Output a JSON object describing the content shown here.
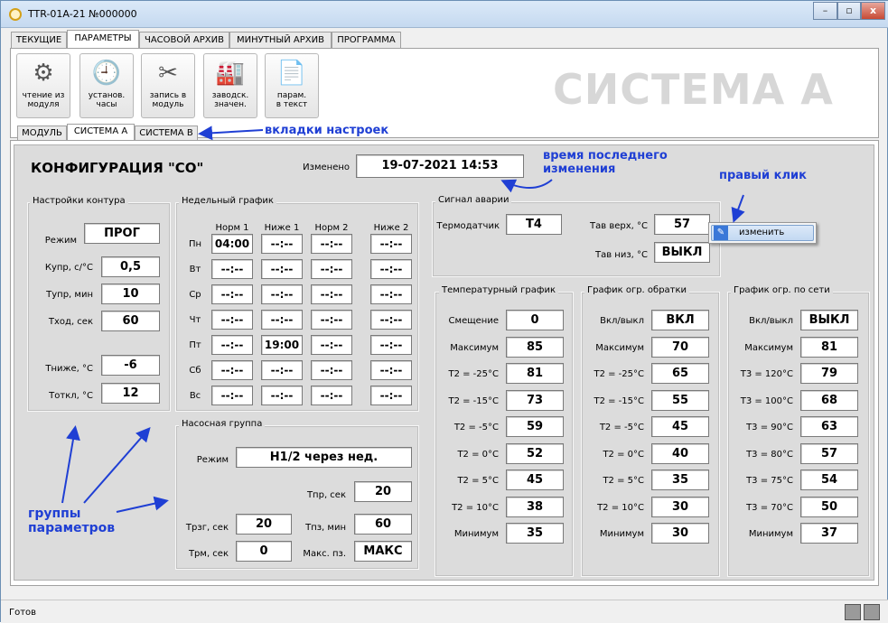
{
  "window": {
    "title": "TTR-01A-21 №000000",
    "min": "–",
    "max": "▫",
    "close": "x"
  },
  "tabs": [
    "ТЕКУЩИЕ",
    "ПАРАМЕТРЫ",
    "ЧАСОВОЙ АРХИВ",
    "МИНУТНЫЙ АРХИВ",
    "ПРОГРАММА"
  ],
  "toolbar": [
    {
      "l1": "чтение из",
      "l2": "модуля",
      "icon": "gear-icon"
    },
    {
      "l1": "установ.",
      "l2": "часы",
      "icon": "clock-icon"
    },
    {
      "l1": "запись в",
      "l2": "модуль",
      "icon": "tools-icon"
    },
    {
      "l1": "заводск.",
      "l2": "значен.",
      "icon": "factory-icon"
    },
    {
      "l1": "парам.",
      "l2": "в текст",
      "icon": "document-icon"
    }
  ],
  "big_title": "СИСТЕМА А",
  "subtabs": [
    "МОДУЛЬ",
    "СИСТЕМА А",
    "СИСТЕМА В"
  ],
  "annotations": {
    "tabs": "вкладки настроек",
    "time1": "время последнего",
    "time2": "изменения",
    "right_click": "правый клик",
    "groups1": "группы",
    "groups2": "параметров"
  },
  "config": {
    "title": "КОНФИГУРАЦИЯ \"СО\"",
    "changed_label": "Изменено",
    "changed_value": "19-07-2021 14:53"
  },
  "contour": {
    "title": "Настройки контура",
    "mode_label": "Режим",
    "mode_value": "ПРОГ",
    "rows": [
      {
        "label": "Купр, с/°С",
        "value": "0,5"
      },
      {
        "label": "Тупр, мин",
        "value": "10"
      },
      {
        "label": "Тход, сек",
        "value": "60"
      },
      {
        "label": "Тниже, °С",
        "value": "-6"
      },
      {
        "label": "Тоткл, °С",
        "value": "12"
      }
    ]
  },
  "weekly": {
    "title": "Недельный график",
    "cols": [
      "Норм 1",
      "Ниже 1",
      "Норм 2",
      "Ниже 2"
    ],
    "days": [
      "Пн",
      "Вт",
      "Ср",
      "Чт",
      "Пт",
      "Сб",
      "Вс"
    ],
    "cells": [
      [
        "04:00",
        "--:--",
        "--:--",
        "--:--"
      ],
      [
        "--:--",
        "--:--",
        "--:--",
        "--:--"
      ],
      [
        "--:--",
        "--:--",
        "--:--",
        "--:--"
      ],
      [
        "--:--",
        "--:--",
        "--:--",
        "--:--"
      ],
      [
        "--:--",
        "19:00",
        "--:--",
        "--:--"
      ],
      [
        "--:--",
        "--:--",
        "--:--",
        "--:--"
      ],
      [
        "--:--",
        "--:--",
        "--:--",
        "--:--"
      ]
    ]
  },
  "pump": {
    "title": "Насосная группа",
    "mode_label": "Режим",
    "mode_value": "Н1/2 через нед.",
    "tpr_label": "Тпр, сек",
    "tpr_value": "20",
    "trzg_label": "Трзг, сек",
    "trzg_value": "20",
    "tpz_label": "Тпз, мин",
    "tpz_value": "60",
    "trm_label": "Трм, сек",
    "trm_value": "0",
    "maxpz_label": "Макс. пз.",
    "maxpz_value": "МАКС"
  },
  "alarm": {
    "title": "Сигнал аварии",
    "sensor_label": "Термодатчик",
    "sensor_value": "Т4",
    "tup_label": "Тав верх, °С",
    "tup_value": "57",
    "tlow_label": "Тав низ, °С",
    "tlow_value": "ВЫКЛ"
  },
  "context_menu": {
    "item": "изменить"
  },
  "temp_graph": {
    "title": "Температурный график",
    "rows": [
      {
        "label": "Смещение",
        "value": "0"
      },
      {
        "label": "Максимум",
        "value": "85"
      },
      {
        "label": "Т2 = -25°С",
        "value": "81"
      },
      {
        "label": "Т2 = -15°С",
        "value": "73"
      },
      {
        "label": "Т2 = -5°С",
        "value": "59"
      },
      {
        "label": "Т2 = 0°С",
        "value": "52"
      },
      {
        "label": "Т2 = 5°С",
        "value": "45"
      },
      {
        "label": "Т2 = 10°С",
        "value": "38"
      },
      {
        "label": "Минимум",
        "value": "35"
      }
    ]
  },
  "return_graph": {
    "title": "График огр. обратки",
    "rows": [
      {
        "label": "Вкл/выкл",
        "value": "ВКЛ"
      },
      {
        "label": "Максимум",
        "value": "70"
      },
      {
        "label": "Т2 = -25°С",
        "value": "65"
      },
      {
        "label": "Т2 = -15°С",
        "value": "55"
      },
      {
        "label": "Т2 = -5°С",
        "value": "45"
      },
      {
        "label": "Т2 = 0°С",
        "value": "40"
      },
      {
        "label": "Т2 = 5°С",
        "value": "35"
      },
      {
        "label": "Т2 = 10°С",
        "value": "30"
      },
      {
        "label": "Минимум",
        "value": "30"
      }
    ]
  },
  "net_graph": {
    "title": "График огр. по сети",
    "rows": [
      {
        "label": "Вкл/выкл",
        "value": "ВЫКЛ"
      },
      {
        "label": "Максимум",
        "value": "81"
      },
      {
        "label": "Т3 = 120°С",
        "value": "79"
      },
      {
        "label": "Т3 = 100°С",
        "value": "68"
      },
      {
        "label": "Т3 = 90°С",
        "value": "63"
      },
      {
        "label": "Т3 = 80°С",
        "value": "57"
      },
      {
        "label": "Т3 = 75°С",
        "value": "54"
      },
      {
        "label": "Т3 = 70°С",
        "value": "50"
      },
      {
        "label": "Минимум",
        "value": "37"
      }
    ]
  },
  "status": {
    "text": "Готов"
  },
  "colors": {
    "annotation": "#1f3fd4",
    "accent": "#3a78d8"
  }
}
